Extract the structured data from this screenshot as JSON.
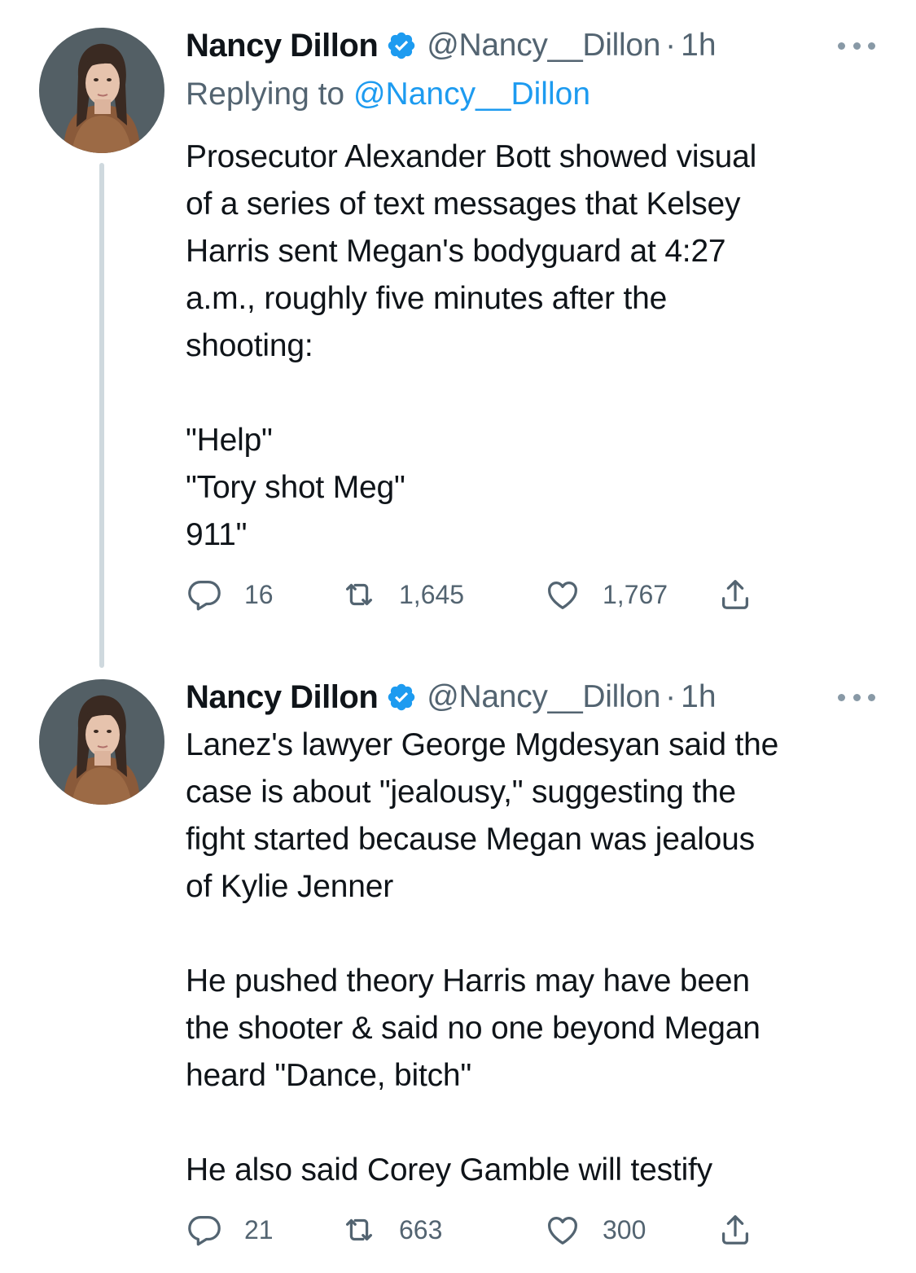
{
  "tweets": [
    {
      "author": {
        "display_name": "Nancy Dillon",
        "handle": "@Nancy__Dillon",
        "separator": "·",
        "time": "1h",
        "verified": true
      },
      "replying": {
        "prefix": "Replying to ",
        "handle": "@Nancy__Dillon"
      },
      "text": "Prosecutor Alexander Bott showed visual\nof a series of text messages that Kelsey\nHarris sent Megan's bodyguard at 4:27\na.m., roughly five minutes after the\nshooting:\n\n\"Help\"\n\"Tory shot Meg\"\n911\"",
      "stats": {
        "replies": "16",
        "retweets": "1,645",
        "likes": "1,767"
      }
    },
    {
      "author": {
        "display_name": "Nancy Dillon",
        "handle": "@Nancy__Dillon",
        "separator": "·",
        "time": "1h",
        "verified": true
      },
      "text": "Lanez's lawyer George Mgdesyan said the\ncase is about \"jealousy,\" suggesting the\nfight started because Megan was jealous\nof Kylie Jenner\n\nHe pushed theory Harris may have been\nthe shooter & said no one beyond Megan\nheard \"Dance, bitch\"\n\nHe also said Corey Gamble will testify",
      "stats": {
        "replies": "21",
        "retweets": "663",
        "likes": "300"
      }
    }
  ],
  "colors": {
    "text": "#0f1419",
    "secondary": "#536471",
    "link": "#1d9bf0",
    "verified": "#1d9bf0",
    "thread_line": "#cfd9de"
  },
  "icons": {
    "verified": "verified-badge-icon",
    "more": "more-options-icon",
    "reply": "reply-icon",
    "retweet": "retweet-icon",
    "like": "heart-icon",
    "share": "share-icon"
  }
}
